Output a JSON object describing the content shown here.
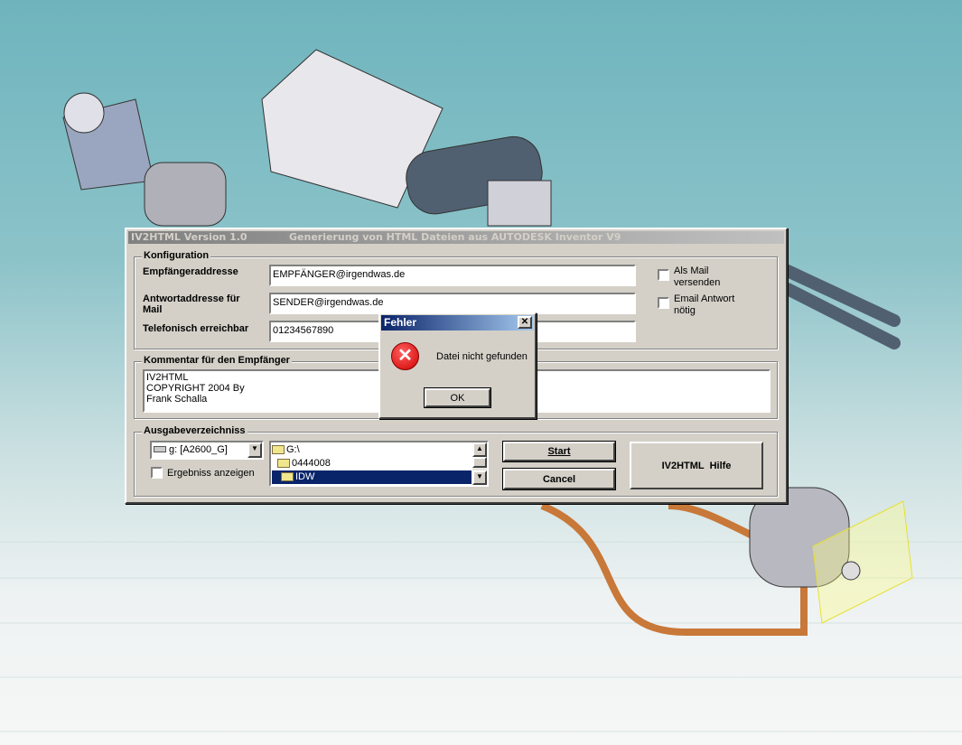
{
  "main_window": {
    "title": "IV2HTML Version 1.0",
    "subtitle": "Generierung von HTML Dateien aus AUTODESK Inventor V9",
    "konfiguration": {
      "group_label": "Konfiguration",
      "recipient_label": "Empfängeraddresse",
      "recipient_value": "EMPFÄNGER@irgendwas.de",
      "reply_label": "Antwortaddresse für Mail",
      "reply_value": "SENDER@irgendwas.de",
      "phone_label": "Telefonisch erreichbar",
      "phone_value": "01234567890",
      "send_mail_label": "Als Mail versenden",
      "reply_needed_label": "Email Antwort nötig"
    },
    "kommentar": {
      "group_label": "Kommentar für den Empfänger",
      "lines": [
        "IV2HTML",
        "COPYRIGHT 2004 By",
        "Frank Schalla"
      ]
    },
    "ausgabe": {
      "group_label": "Ausgabeverzeichniss",
      "drive": "g: [A2600_G]",
      "show_result_label": "Ergebniss anzeigen",
      "folders": [
        "G:\\",
        "0444008",
        "IDW"
      ],
      "selected_folder": "IDW"
    },
    "buttons": {
      "start": "Start",
      "cancel": "Cancel",
      "help": "IV2HTML  Hilfe"
    }
  },
  "error_dialog": {
    "title": "Fehler",
    "message": "Datei nicht gefunden",
    "ok": "OK",
    "close": "✕"
  }
}
